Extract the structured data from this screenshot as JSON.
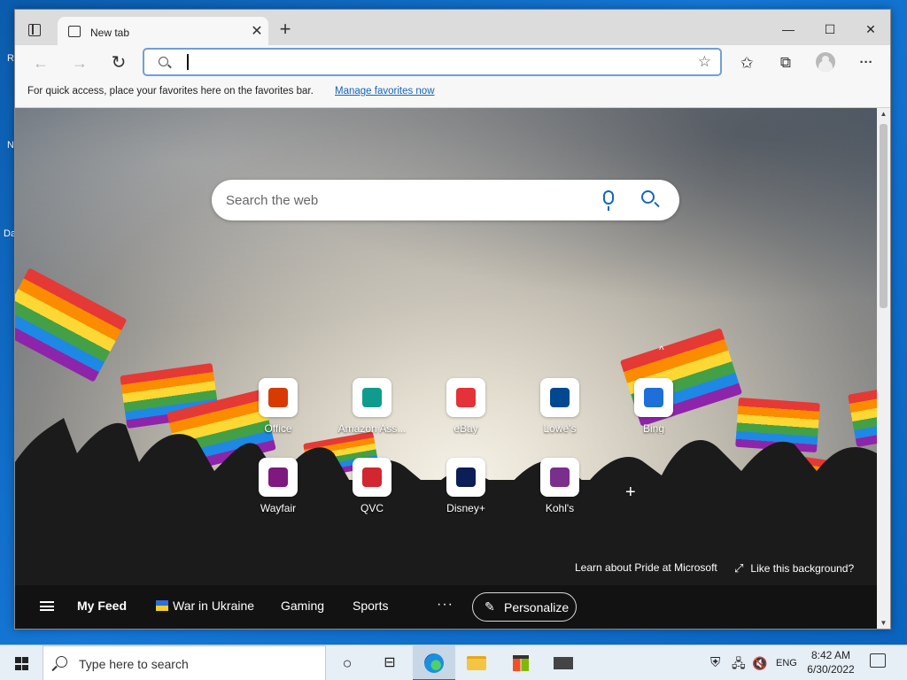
{
  "desktop": {
    "icon_labels": [
      "R",
      "N",
      "Da"
    ]
  },
  "browser": {
    "tab": {
      "title": "New tab",
      "close_glyph": "✕",
      "icon": "new-tab-page-icon"
    },
    "new_tab_glyph": "+",
    "window_controls": {
      "minimize": "—",
      "maximize": "☐",
      "close": "✕"
    },
    "toolbar": {
      "back": "←",
      "forward": "→",
      "refresh": "↻",
      "address_value": "",
      "add_favorite_glyph": "☆",
      "favorites_glyph": "✩",
      "collections_glyph": "⧉",
      "more_glyph": "···"
    },
    "favorites_bar": {
      "message": "For quick access, place your favorites here on the favorites bar.",
      "link": "Manage favorites now"
    }
  },
  "newtab": {
    "search": {
      "placeholder": "Search the web"
    },
    "collapse_glyph": "^",
    "quick_links": [
      {
        "label": "Office",
        "icon": "office-icon",
        "color": "#d83b01"
      },
      {
        "label": "Amazon Ass...",
        "icon": "amazon-assistant-icon",
        "color": "#0f9c8f"
      },
      {
        "label": "eBay",
        "icon": "ebay-icon",
        "color": "#e53238"
      },
      {
        "label": "Lowe's",
        "icon": "lowes-icon",
        "color": "#004990"
      },
      {
        "label": "Bing",
        "icon": "bing-icon",
        "color": "#1e6fd9"
      },
      {
        "label": "Wayfair",
        "icon": "wayfair-icon",
        "color": "#7f187f"
      },
      {
        "label": "QVC",
        "icon": "qvc-icon",
        "color": "#d22630"
      },
      {
        "label": "Disney+",
        "icon": "disney-plus-icon",
        "color": "#0c1e56"
      },
      {
        "label": "Kohl's",
        "icon": "kohls-icon",
        "color": "#7a2f8c"
      }
    ],
    "add_glyph": "+",
    "pride_link": "Learn about Pride at Microsoft",
    "like_background": "Like this background?",
    "feed": {
      "my_feed": "My Feed",
      "items": [
        "War in Ukraine",
        "Gaming",
        "Sports"
      ],
      "more_glyph": "···",
      "personalize": "Personalize"
    }
  },
  "taskbar": {
    "search_placeholder": "Type here to search",
    "language": "ENG",
    "time": "8:42 AM",
    "date": "6/30/2022"
  }
}
